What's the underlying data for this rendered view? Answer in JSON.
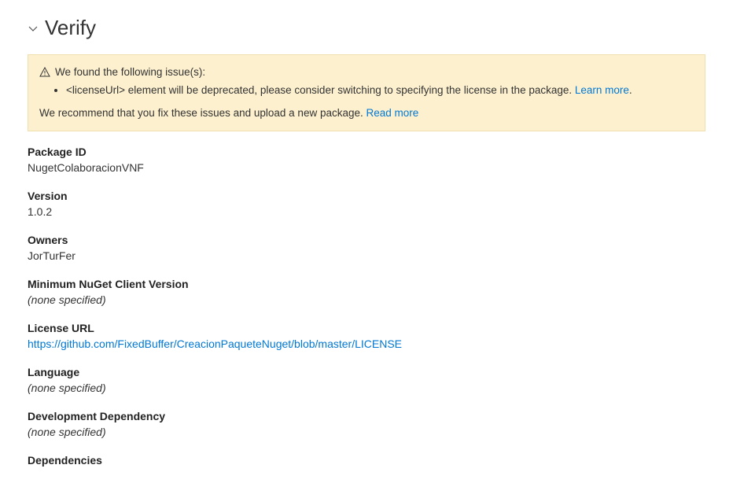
{
  "section": {
    "title": "Verify"
  },
  "warning": {
    "intro": "We found the following issue(s):",
    "issue1": "<licenseUrl> element will be deprecated, please consider switching to specifying the license in the package. ",
    "learn_more": "Learn more",
    "recommend": "We recommend that you fix these issues and upload a new package. ",
    "read_more": "Read more"
  },
  "fields": {
    "package_id": {
      "label": "Package ID",
      "value": "NugetColaboracionVNF"
    },
    "version": {
      "label": "Version",
      "value": "1.0.2"
    },
    "owners": {
      "label": "Owners",
      "value": "JorTurFer"
    },
    "min_client": {
      "label": "Minimum NuGet Client Version",
      "value": "(none specified)"
    },
    "license_url": {
      "label": "License URL",
      "value": "https://github.com/FixedBuffer/CreacionPaqueteNuget/blob/master/LICENSE"
    },
    "language": {
      "label": "Language",
      "value": "(none specified)"
    },
    "dev_dependency": {
      "label": "Development Dependency",
      "value": "(none specified)"
    },
    "dependencies": {
      "label": "Dependencies"
    }
  }
}
